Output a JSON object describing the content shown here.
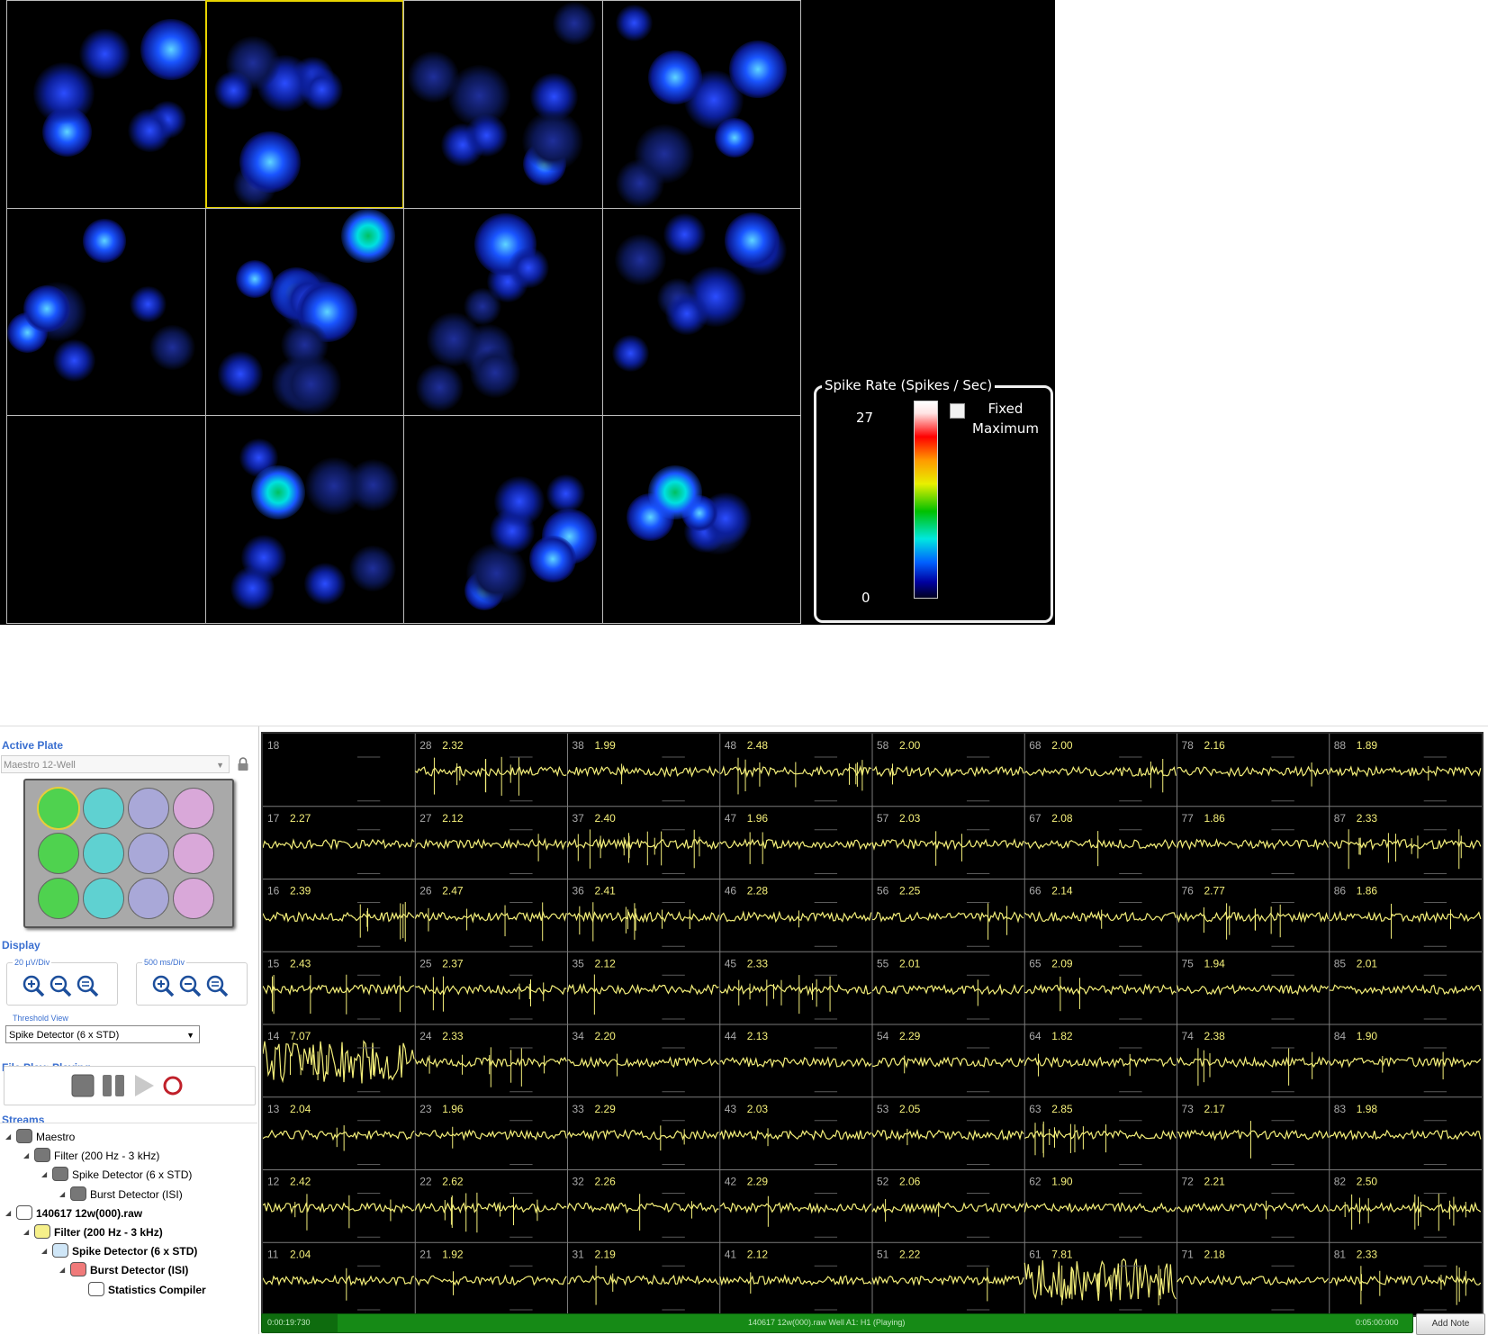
{
  "heatmap": {
    "selected_well": 1,
    "legend": {
      "title": "Spike Rate (Spikes / Sec)",
      "max": "27",
      "min": "0",
      "fixed_label": "Fixed Maximum",
      "fixed_checked": false
    }
  },
  "sidebar": {
    "active_plate": {
      "title": "Active Plate",
      "plate_name": "Maestro 12-Well",
      "well_colors": [
        "#4fd24f",
        "#5fd1d1",
        "#a9a8d8",
        "#d9a8d9"
      ]
    },
    "display": {
      "title": "Display",
      "amplitude_label": "20 µV/Div",
      "time_label": "500 ms/Div",
      "threshold_view_label": "Threshold View",
      "threshold_view_value": "Spike Detector (6 x STD)"
    },
    "file_play": {
      "title": "File Play: Playing"
    },
    "streams": {
      "title": "Streams",
      "items": [
        {
          "label": "Maestro",
          "depth": 0,
          "color": "#777777",
          "bold": false
        },
        {
          "label": "Filter (200 Hz - 3 kHz)",
          "depth": 1,
          "color": "#777777",
          "bold": false
        },
        {
          "label": "Spike Detector (6 x STD)",
          "depth": 2,
          "color": "#777777",
          "bold": false
        },
        {
          "label": "Burst Detector (ISI)",
          "depth": 3,
          "color": "#777777",
          "bold": false
        },
        {
          "label": "140617 12w(000).raw",
          "depth": 0,
          "color": "#ffffff",
          "bold": true
        },
        {
          "label": "Filter (200 Hz - 3 kHz)",
          "depth": 1,
          "color": "#f6f08a",
          "bold": true
        },
        {
          "label": "Spike Detector (6 x STD)",
          "depth": 2,
          "color": "#cfe6f7",
          "bold": true
        },
        {
          "label": "Burst Detector (ISI)",
          "depth": 3,
          "color": "#f07a7a",
          "bold": true
        },
        {
          "label": "Statistics Compiler",
          "depth": 4,
          "color": "#ffffff",
          "bold": true
        }
      ]
    }
  },
  "traces": {
    "rows": [
      [
        [
          "18",
          ""
        ],
        [
          "28",
          "2.32"
        ],
        [
          "38",
          "1.99"
        ],
        [
          "48",
          "2.48"
        ],
        [
          "58",
          "2.00"
        ],
        [
          "68",
          "2.00"
        ],
        [
          "78",
          "2.16"
        ],
        [
          "88",
          "1.89"
        ]
      ],
      [
        [
          "17",
          "2.27"
        ],
        [
          "27",
          "2.12"
        ],
        [
          "37",
          "2.40"
        ],
        [
          "47",
          "1.96"
        ],
        [
          "57",
          "2.03"
        ],
        [
          "67",
          "2.08"
        ],
        [
          "77",
          "1.86"
        ],
        [
          "87",
          "2.33"
        ]
      ],
      [
        [
          "16",
          "2.39"
        ],
        [
          "26",
          "2.47"
        ],
        [
          "36",
          "2.41"
        ],
        [
          "46",
          "2.28"
        ],
        [
          "56",
          "2.25"
        ],
        [
          "66",
          "2.14"
        ],
        [
          "76",
          "2.77"
        ],
        [
          "86",
          "1.86"
        ]
      ],
      [
        [
          "15",
          "2.43"
        ],
        [
          "25",
          "2.37"
        ],
        [
          "35",
          "2.12"
        ],
        [
          "45",
          "2.33"
        ],
        [
          "55",
          "2.01"
        ],
        [
          "65",
          "2.09"
        ],
        [
          "75",
          "1.94"
        ],
        [
          "85",
          "2.01"
        ]
      ],
      [
        [
          "14",
          "7.07"
        ],
        [
          "24",
          "2.33"
        ],
        [
          "34",
          "2.20"
        ],
        [
          "44",
          "2.13"
        ],
        [
          "54",
          "2.29"
        ],
        [
          "64",
          "1.82"
        ],
        [
          "74",
          "2.38"
        ],
        [
          "84",
          "1.90"
        ]
      ],
      [
        [
          "13",
          "2.04"
        ],
        [
          "23",
          "1.96"
        ],
        [
          "33",
          "2.29"
        ],
        [
          "43",
          "2.03"
        ],
        [
          "53",
          "2.05"
        ],
        [
          "63",
          "2.85"
        ],
        [
          "73",
          "2.17"
        ],
        [
          "83",
          "1.98"
        ]
      ],
      [
        [
          "12",
          "2.42"
        ],
        [
          "22",
          "2.62"
        ],
        [
          "32",
          "2.26"
        ],
        [
          "42",
          "2.29"
        ],
        [
          "52",
          "2.06"
        ],
        [
          "62",
          "1.90"
        ],
        [
          "72",
          "2.21"
        ],
        [
          "82",
          "2.50"
        ]
      ],
      [
        [
          "11",
          "2.04"
        ],
        [
          "21",
          "1.92"
        ],
        [
          "31",
          "2.19"
        ],
        [
          "41",
          "2.12"
        ],
        [
          "51",
          "2.22"
        ],
        [
          "61",
          "7.81"
        ],
        [
          "71",
          "2.18"
        ],
        [
          "81",
          "2.33"
        ]
      ]
    ]
  },
  "statusbar": {
    "elapsed": "0:00:19:730",
    "message": "140617 12w(000).raw Well A1: H1 (Playing)",
    "total": "0:05:00:000",
    "add_note_label": "Add Note",
    "progress": 0.066
  }
}
